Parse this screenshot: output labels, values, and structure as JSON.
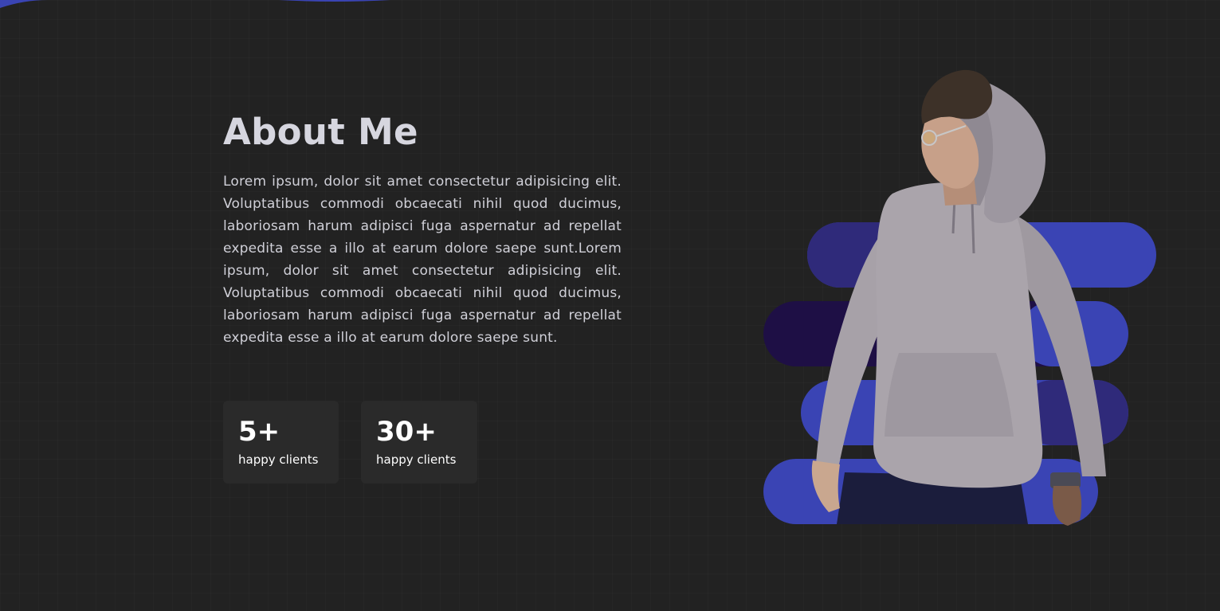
{
  "about": {
    "title": "About Me",
    "paragraph": "Lorem ipsum, dolor sit amet consectetur adipisicing elit. Voluptatibus commodi obcaecati nihil quod ducimus, laboriosam harum adipisci fuga aspernatur ad repellat expedita esse a illo at earum dolore saepe sunt.Lorem ipsum, dolor sit amet consectetur adipisicing elit. Voluptatibus commodi obcaecati nihil quod ducimus, laboriosam harum adipisci fuga aspernatur ad repellat expedita esse a illo at earum dolore saepe sunt."
  },
  "stats": [
    {
      "value": "5+",
      "label": "happy clients"
    },
    {
      "value": "30+",
      "label": "happy clients"
    }
  ],
  "colors": {
    "background": "#222222",
    "accent": "#3a44b4",
    "accent_dark": "#2f2a7a",
    "accent_deep": "#1e0f45",
    "card": "#2a2a2a",
    "title": "#d6d6df",
    "text": "#d0d0d8"
  },
  "hero": {
    "image": "person-in-hoodie-illustration"
  }
}
